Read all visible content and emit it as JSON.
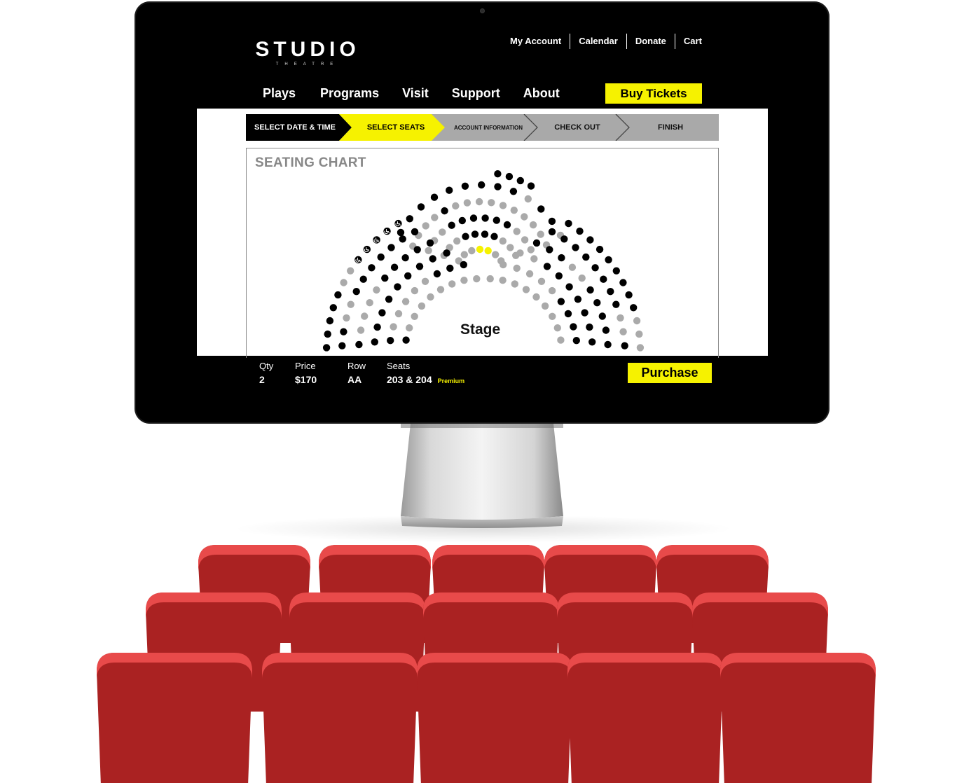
{
  "site": {
    "logo_main": "STUDIO",
    "logo_sub": "THEATRE"
  },
  "utility_nav": [
    "My Account",
    "Calendar",
    "Donate",
    "Cart"
  ],
  "main_nav": [
    "Plays",
    "Programs",
    "Visit",
    "Support",
    "About"
  ],
  "buy_tickets_label": "Buy Tickets",
  "steps": [
    {
      "label": "SELECT DATE & TIME",
      "state": "done"
    },
    {
      "label": "SELECT SEATS",
      "state": "current"
    },
    {
      "label": "ACCOUNT INFORMATION",
      "state": "upcoming"
    },
    {
      "label": "CHECK OUT",
      "state": "upcoming"
    },
    {
      "label": "FINISH",
      "state": "upcoming"
    }
  ],
  "seating_chart": {
    "title": "SEATING CHART",
    "stage_label": "Stage",
    "seat_colors": {
      "available": "#000000",
      "unavailable": "#aaaaaa",
      "selected": "#f6f200"
    },
    "accessible_icon": "wheelchair-icon"
  },
  "order": {
    "qty_label": "Qty",
    "qty": "2",
    "price_label": "Price",
    "price": "$170",
    "row_label": "Row",
    "row": "AA",
    "seats_label": "Seats",
    "seats": "203 & 204",
    "tier": "Premium"
  },
  "purchase_label": "Purchase",
  "colors": {
    "accent": "#f6f200",
    "screen": "#000000",
    "chair": "#aa2222",
    "chair_top": "#e84a4a"
  }
}
